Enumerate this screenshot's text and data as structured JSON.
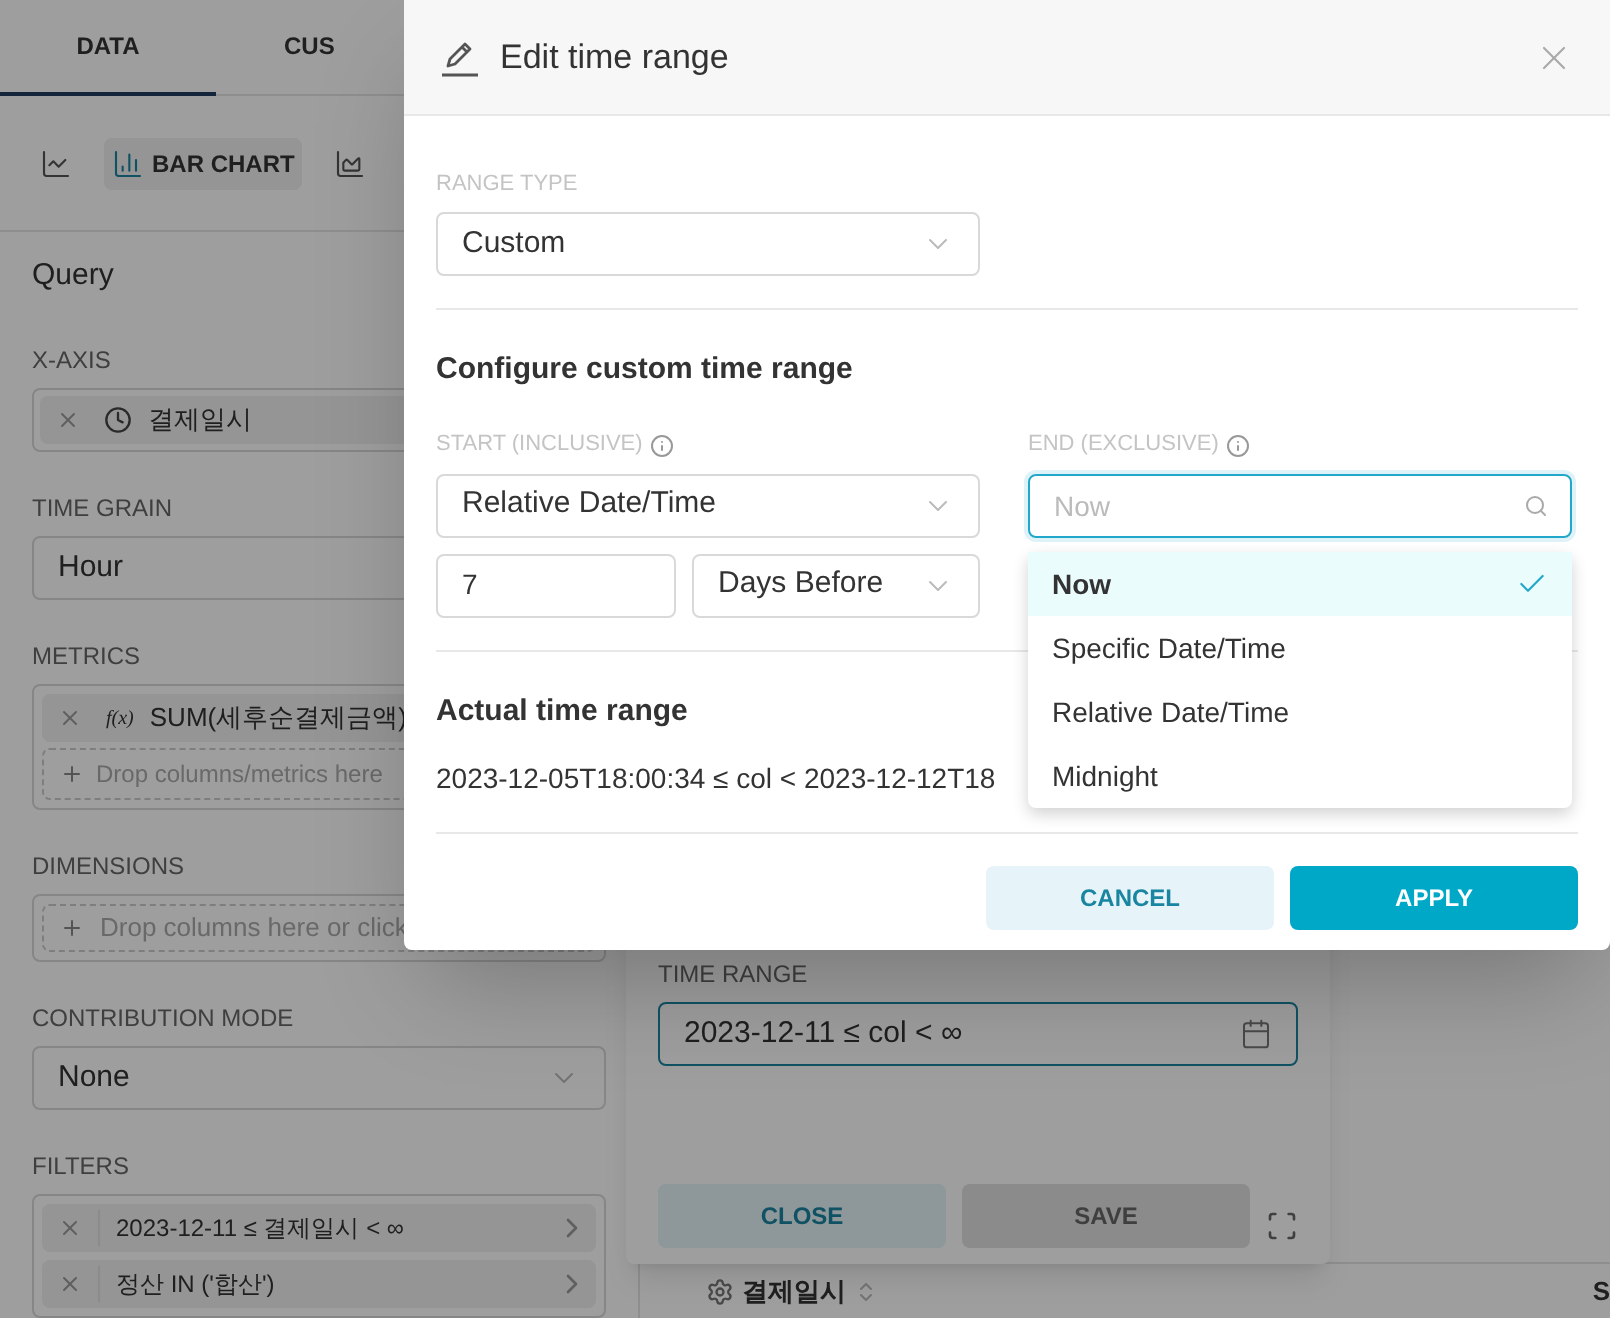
{
  "left_panel": {
    "tabs": [
      {
        "label": "DATA",
        "selected": true
      },
      {
        "label": "CUS",
        "selected": false
      }
    ],
    "chart_types": [
      {
        "kind": "line",
        "selected": false
      },
      {
        "kind": "bar",
        "label": "BAR CHART",
        "selected": true
      },
      {
        "kind": "area",
        "selected": false
      }
    ],
    "section_title": "Query",
    "x_axis": {
      "label": "X-AXIS",
      "value": "결제일시"
    },
    "time_grain": {
      "label": "TIME GRAIN",
      "value": "Hour"
    },
    "metrics": {
      "label": "METRICS",
      "items": [
        {
          "function": "f(x)",
          "label": "SUM(세후순결제금액)"
        }
      ],
      "drop_hint": "Drop columns/metrics here"
    },
    "dimensions": {
      "label": "DIMENSIONS",
      "drop_hint": "Drop columns here or click"
    },
    "contribution_mode": {
      "label": "CONTRIBUTION MODE",
      "value": "None"
    },
    "filters": {
      "label": "FILTERS",
      "items": [
        "2023-12-11 ≤ 결제일시 < ∞",
        "정산 IN ('합산')"
      ]
    }
  },
  "popover": {
    "label": "TIME RANGE",
    "value": "2023-12-11 ≤ col < ∞",
    "buttons": [
      {
        "label": "CLOSE",
        "kind": "secondary"
      },
      {
        "label": "SAVE",
        "kind": "disabled"
      }
    ]
  },
  "table": {
    "columns": [
      "결제일시",
      "S"
    ]
  },
  "modal": {
    "title": "Edit time range",
    "range_type": {
      "label": "RANGE TYPE",
      "value": "Custom"
    },
    "section_title": "Configure custom time range",
    "start": {
      "label": "START (INCLUSIVE)",
      "value": "Relative Date/Time",
      "amount": "7",
      "unit": "Days Before"
    },
    "end": {
      "label": "END (EXCLUSIVE)",
      "placeholder": "Now",
      "options": [
        {
          "label": "Now",
          "selected": true
        },
        {
          "label": "Specific Date/Time",
          "selected": false
        },
        {
          "label": "Relative Date/Time",
          "selected": false
        },
        {
          "label": "Midnight",
          "selected": false
        }
      ]
    },
    "actual": {
      "title": "Actual time range",
      "value": "2023-12-05T18:00:34 ≤ col < 2023-12-12T18"
    },
    "buttons": [
      {
        "label": "CANCEL",
        "kind": "secondary"
      },
      {
        "label": "APPLY",
        "kind": "primary"
      }
    ]
  }
}
